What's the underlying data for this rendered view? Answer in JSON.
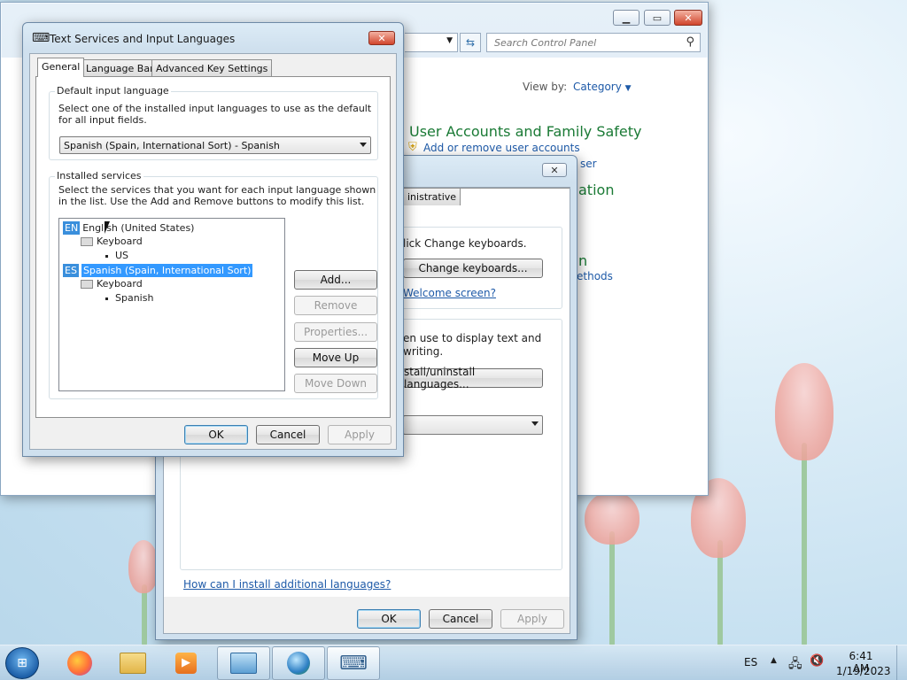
{
  "control_panel": {
    "search_placeholder": "Search Control Panel",
    "view_by_label": "View by:",
    "view_by_value": "Category",
    "category_title": "User Accounts and Family Safety",
    "category_link": "Add or remove user accounts",
    "partial_user": "ser",
    "partial_ation": "ation",
    "partial_n": "n",
    "partial_methods": "ethods"
  },
  "region_dialog": {
    "tab_partial": "inistrative",
    "text_keyboards": "lick Change keyboards.",
    "change_keyboards_button": "Change keyboards...",
    "welcome_link": "Welcome screen?",
    "display_text_line1": "en use to display text and",
    "display_text_line2": "writing.",
    "install_languages_button": "stall/uninstall languages...",
    "help_link": "How can I install additional languages?",
    "ok": "OK",
    "cancel": "Cancel",
    "apply": "Apply"
  },
  "text_services": {
    "title": "Text Services and Input Languages",
    "tabs": [
      "General",
      "Language Bar",
      "Advanced Key Settings"
    ],
    "default_group_label": "Default input language",
    "default_desc": "Select one of the installed input languages to use as the default for all input fields.",
    "default_value": "Spanish (Spain, International Sort) - Spanish",
    "installed_group_label": "Installed services",
    "installed_desc": "Select the services that you want for each input language shown in the list. Use the Add and Remove buttons to modify this list.",
    "tree": {
      "en_badge": "EN",
      "en_label": "English (United States)",
      "en_keyboard": "Keyboard",
      "en_layout": "US",
      "es_badge": "ES",
      "es_label": "Spanish (Spain, International Sort)",
      "es_keyboard": "Keyboard",
      "es_layout": "Spanish"
    },
    "buttons": {
      "add": "Add...",
      "remove": "Remove",
      "properties": "Properties...",
      "move_up": "Move Up",
      "move_down": "Move Down",
      "ok": "OK",
      "cancel": "Cancel",
      "apply": "Apply"
    }
  },
  "taskbar": {
    "language": "ES",
    "time": "6:41 AM",
    "date": "1/19/2023"
  }
}
